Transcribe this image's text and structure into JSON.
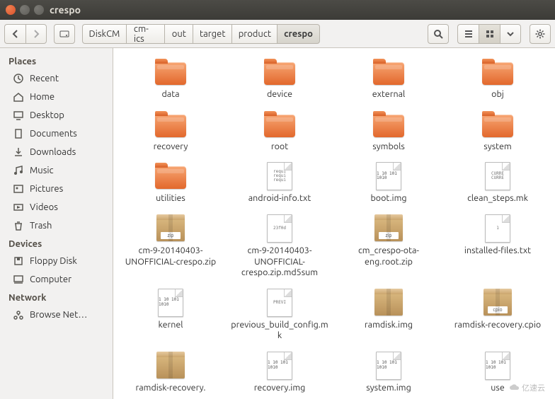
{
  "window": {
    "title": "crespo"
  },
  "toolbar": {
    "path": [
      "DiskCM",
      "cm-ics",
      "out",
      "target",
      "product",
      "crespo"
    ],
    "current_index": 5
  },
  "sidebar": {
    "sections": [
      {
        "header": "Places",
        "items": [
          {
            "label": "Recent",
            "icon": "clock-icon"
          },
          {
            "label": "Home",
            "icon": "home-icon"
          },
          {
            "label": "Desktop",
            "icon": "desktop-icon"
          },
          {
            "label": "Documents",
            "icon": "documents-icon"
          },
          {
            "label": "Downloads",
            "icon": "downloads-icon"
          },
          {
            "label": "Music",
            "icon": "music-icon"
          },
          {
            "label": "Pictures",
            "icon": "pictures-icon"
          },
          {
            "label": "Videos",
            "icon": "videos-icon"
          },
          {
            "label": "Trash",
            "icon": "trash-icon"
          }
        ]
      },
      {
        "header": "Devices",
        "items": [
          {
            "label": "Floppy Disk",
            "icon": "floppy-icon"
          },
          {
            "label": "Computer",
            "icon": "computer-icon"
          }
        ]
      },
      {
        "header": "Network",
        "items": [
          {
            "label": "Browse Net…",
            "icon": "network-icon"
          }
        ]
      }
    ]
  },
  "files": [
    {
      "name": "data",
      "type": "folder"
    },
    {
      "name": "device",
      "type": "folder"
    },
    {
      "name": "external",
      "type": "folder"
    },
    {
      "name": "obj",
      "type": "folder"
    },
    {
      "name": "recovery",
      "type": "folder"
    },
    {
      "name": "root",
      "type": "folder"
    },
    {
      "name": "symbols",
      "type": "folder"
    },
    {
      "name": "system",
      "type": "folder"
    },
    {
      "name": "utilities",
      "type": "folder"
    },
    {
      "name": "android-info.txt",
      "type": "text",
      "preview": "requi\nrequi\nrequi"
    },
    {
      "name": "boot.img",
      "type": "binary",
      "preview": "1\n10\n101\n1010"
    },
    {
      "name": "clean_steps.mk",
      "type": "text",
      "preview": "CURRE\nCURRE"
    },
    {
      "name": "cm-9-20140403-UNOFFICIAL-crespo.zip",
      "type": "package",
      "tag": "zip"
    },
    {
      "name": "cm-9-20140403-UNOFFICIAL-crespo.zip.md5sum",
      "type": "text",
      "preview": "23f0d"
    },
    {
      "name": "cm_crespo-ota-eng.root.zip",
      "type": "package",
      "tag": "zip"
    },
    {
      "name": "installed-files.txt",
      "type": "text",
      "preview": "1"
    },
    {
      "name": "kernel",
      "type": "binary",
      "preview": "1\n10\n101\n1010"
    },
    {
      "name": "previous_build_config.mk",
      "type": "text",
      "preview": "PREVI"
    },
    {
      "name": "ramdisk.img",
      "type": "package",
      "tag": ""
    },
    {
      "name": "ramdisk-recovery.cpio",
      "type": "package",
      "tag": "cpio"
    },
    {
      "name": "ramdisk-recovery.",
      "type": "package",
      "tag": ""
    },
    {
      "name": "recovery.img",
      "type": "binary",
      "preview": "1\n10\n101\n1010"
    },
    {
      "name": "system.img",
      "type": "binary",
      "preview": "1\n10\n101\n1010"
    },
    {
      "name": "use",
      "type": "binary",
      "preview": "1\n10\n101\n1010"
    }
  ],
  "watermark": "亿速云"
}
